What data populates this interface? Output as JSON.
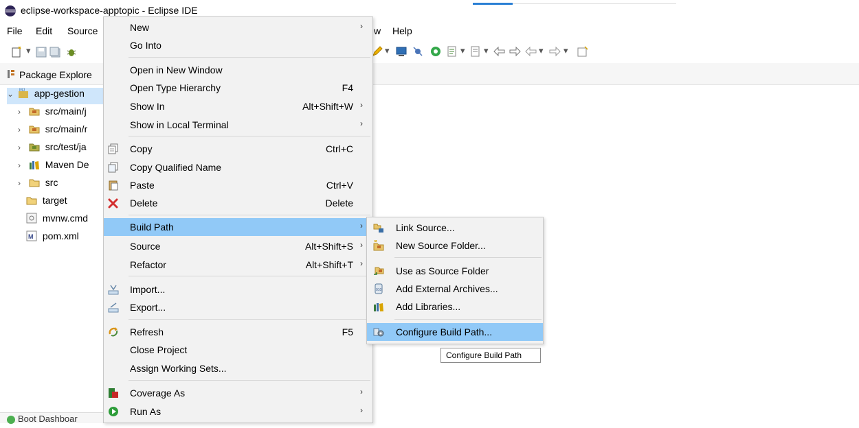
{
  "window": {
    "title": "eclipse-workspace-apptopic - Eclipse IDE"
  },
  "menubar": {
    "file": "File",
    "edit": "Edit",
    "source": "Source",
    "window_partial": "w",
    "help": "Help"
  },
  "view": {
    "title": "Package Explore"
  },
  "tree": [
    {
      "label": "app-gestion",
      "expanded": true,
      "icon": "project-icon"
    },
    {
      "label": "src/main/j",
      "icon": "source-folder-icon"
    },
    {
      "label": "src/main/r",
      "icon": "source-folder-icon"
    },
    {
      "label": "src/test/ja",
      "icon": "source-folder-icon"
    },
    {
      "label": "Maven De",
      "icon": "library-icon"
    },
    {
      "label": "src",
      "icon": "folder-icon"
    },
    {
      "label": "target",
      "icon": "folder-icon"
    },
    {
      "label": "mvnw.cmd",
      "icon": "file-icon"
    },
    {
      "label": "pom.xml",
      "icon": "maven-file-icon"
    }
  ],
  "bottom_view": {
    "title": "Boot Dashboar"
  },
  "context_menu": {
    "items": [
      {
        "label": "New",
        "accel": "",
        "submenu": true
      },
      {
        "label": "Go Into",
        "accel": ""
      },
      {
        "label": "Open in New Window",
        "accel": ""
      },
      {
        "label": "Open Type Hierarchy",
        "accel": "F4"
      },
      {
        "label": "Show In",
        "accel": "Alt+Shift+W",
        "submenu": true
      },
      {
        "label": "Show in Local Terminal",
        "accel": "",
        "submenu": true
      },
      {
        "label": "Copy",
        "accel": "Ctrl+C"
      },
      {
        "label": "Copy Qualified Name",
        "accel": ""
      },
      {
        "label": "Paste",
        "accel": "Ctrl+V"
      },
      {
        "label": "Delete",
        "accel": "Delete"
      },
      {
        "label": "Build Path",
        "accel": "",
        "submenu": true,
        "active": true
      },
      {
        "label": "Source",
        "accel": "Alt+Shift+S",
        "submenu": true
      },
      {
        "label": "Refactor",
        "accel": "Alt+Shift+T",
        "submenu": true
      },
      {
        "label": "Import...",
        "accel": ""
      },
      {
        "label": "Export...",
        "accel": ""
      },
      {
        "label": "Refresh",
        "accel": "F5"
      },
      {
        "label": "Close Project",
        "accel": ""
      },
      {
        "label": "Assign Working Sets...",
        "accel": ""
      },
      {
        "label": "Coverage As",
        "accel": "",
        "submenu": true
      },
      {
        "label": "Run As",
        "accel": "",
        "submenu": true
      }
    ],
    "submenu_glyph": "›"
  },
  "build_path_submenu": {
    "items": [
      {
        "label": "Link Source..."
      },
      {
        "label": "New Source Folder..."
      },
      {
        "label": "Use as Source Folder"
      },
      {
        "label": "Add External Archives..."
      },
      {
        "label": "Add Libraries..."
      },
      {
        "label": "Configure Build Path...",
        "active": true
      }
    ]
  },
  "tooltip": {
    "text": "Configure Build Path"
  },
  "colors": {
    "highlight": "#91c9f7",
    "menu_bg": "#f2f2f2",
    "accent": "#2a7fd4"
  }
}
